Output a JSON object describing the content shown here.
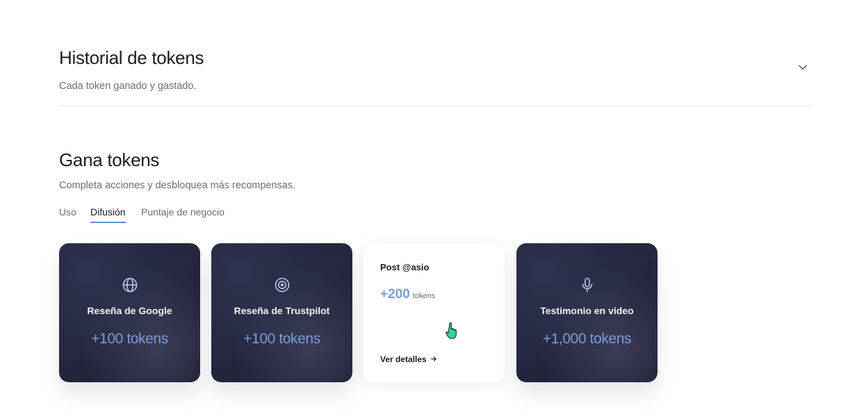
{
  "history": {
    "title": "Historial de tokens",
    "subtitle": "Cada token ganado y gastado.",
    "toggle_icon": "chevron-down-icon"
  },
  "earn": {
    "title": "Gana tokens",
    "subtitle": "Completa acciones y desbloquea más recompensas.",
    "tabs": [
      {
        "label": "Uso",
        "active": false
      },
      {
        "label": "Difusión",
        "active": true
      },
      {
        "label": "Puntaje de negocio",
        "active": false
      }
    ],
    "cards": [
      {
        "icon": "globe-icon",
        "name": "Reseña de Google",
        "amount": "+100 tokens"
      },
      {
        "icon": "target-icon",
        "name": "Reseña de Trustpilot",
        "amount": "+100 tokens"
      },
      {
        "title": "Post @asio",
        "amount": "+200",
        "unit": "tokens",
        "link": "Ver detalles",
        "link_icon": "arrow-right-icon"
      },
      {
        "icon": "microphone-icon",
        "name": "Testimonio en video",
        "amount": "+1,000 tokens"
      }
    ]
  },
  "colors": {
    "accent": "#7f9bd6",
    "tab_underline": "#6a8bd0",
    "card_dark": "#1f2236",
    "cursor": "#2fd6a0"
  }
}
